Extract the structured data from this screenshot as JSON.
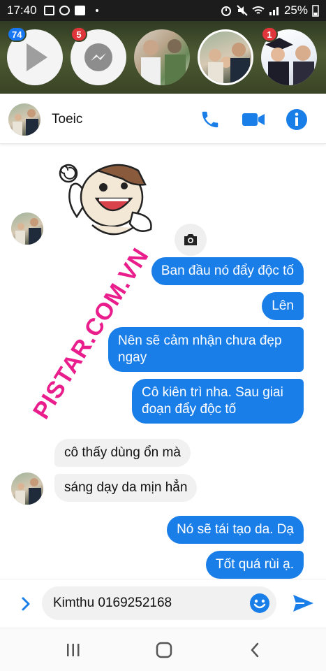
{
  "status_bar": {
    "time": "17:40",
    "battery": "25%"
  },
  "chat_heads": [
    {
      "name": "play-head",
      "badge": "74",
      "badge_color": "#1877f2"
    },
    {
      "name": "messenger-head",
      "badge": "5",
      "badge_color": "#e0353b"
    },
    {
      "name": "group-photo-head",
      "badge": ""
    },
    {
      "name": "family-photo-head",
      "badge": ""
    },
    {
      "name": "graduation-photo-head",
      "badge": "1",
      "badge_color": "#e0353b"
    }
  ],
  "conversation": {
    "title": "Toeic",
    "accent_color": "#1a7ee8"
  },
  "messages": [
    {
      "from": "them",
      "type": "sticker",
      "icon": "cartoon-dog-thumbs-up-sticker"
    },
    {
      "from": "me",
      "text": "Ban đầu nó đẩy độc tố"
    },
    {
      "from": "me",
      "text": "Lên"
    },
    {
      "from": "me",
      "text": "Nên sẽ cảm nhận chưa đẹp ngay"
    },
    {
      "from": "me",
      "text": "Cô kiên trì nha. Sau giai đoạn đẩy độc tố"
    },
    {
      "from": "them",
      "text": "cô thấy dùng ổn mà"
    },
    {
      "from": "them",
      "text": "sáng dạy da mịn hẳn"
    },
    {
      "from": "me",
      "text": "Nó sẽ tái tạo da. Dạ"
    },
    {
      "from": "me",
      "text": "Tốt quá rùi ạ."
    }
  ],
  "watermark": "PISTAR.COM.VN",
  "composer": {
    "value": "Kimthu 0169252168"
  }
}
